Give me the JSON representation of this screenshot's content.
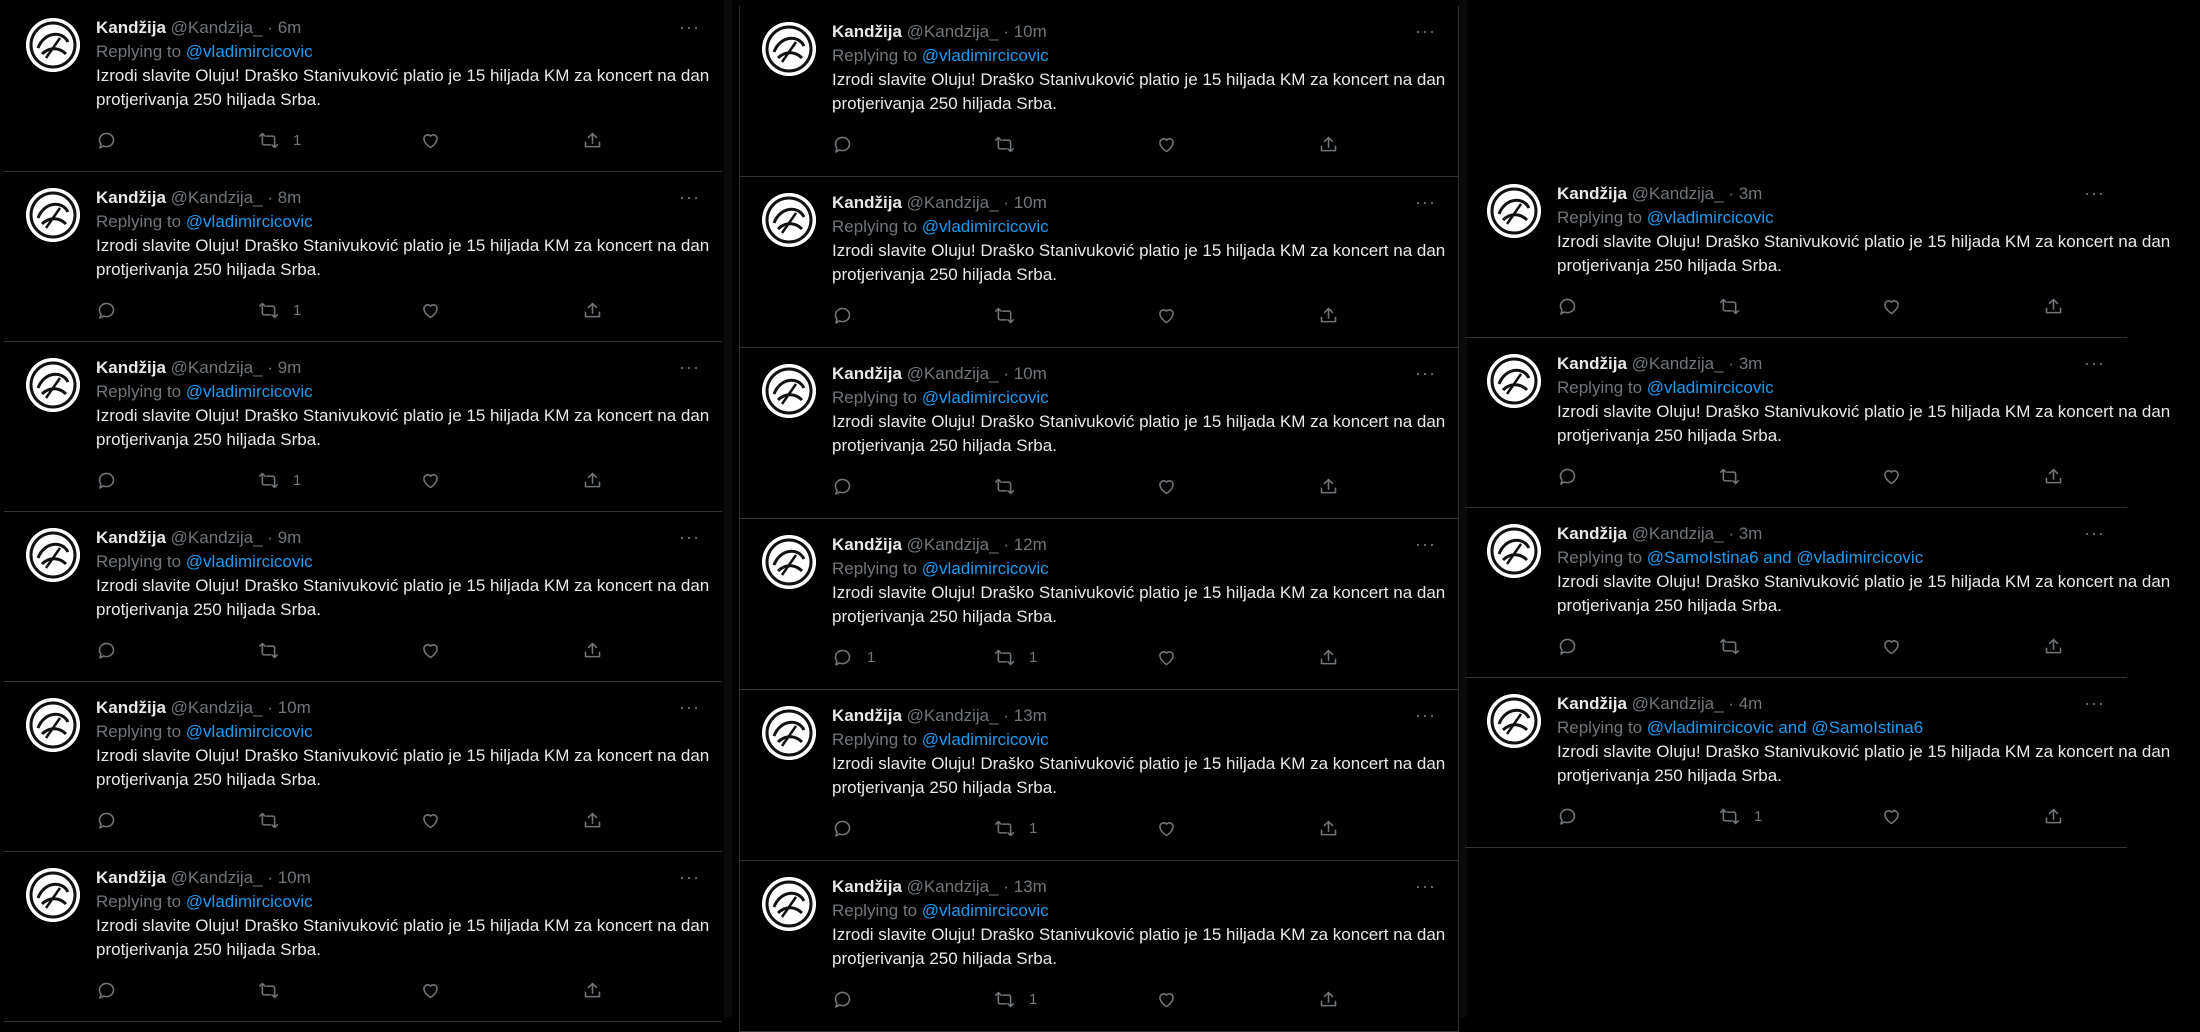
{
  "tweet_text": "Izrodi slavite Oluju! Draško Stanivuković platio je 15 hiljada KM za koncert na dan protjerivanja 250 hiljada Srba.",
  "columns": [
    {
      "tweets": [
        {
          "name": "Kandžija",
          "handle": "@Kandzija_",
          "time": "6m",
          "reply_prefix": "Replying to",
          "mentions": "@vladimircicovic",
          "replies": "",
          "retweets": "1",
          "likes": ""
        },
        {
          "name": "Kandžija",
          "handle": "@Kandzija_",
          "time": "8m",
          "reply_prefix": "Replying to",
          "mentions": "@vladimircicovic",
          "replies": "",
          "retweets": "1",
          "likes": ""
        },
        {
          "name": "Kandžija",
          "handle": "@Kandzija_",
          "time": "9m",
          "reply_prefix": "Replying to",
          "mentions": "@vladimircicovic",
          "replies": "",
          "retweets": "1",
          "likes": ""
        },
        {
          "name": "Kandžija",
          "handle": "@Kandzija_",
          "time": "9m",
          "reply_prefix": "Replying to",
          "mentions": "@vladimircicovic",
          "replies": "",
          "retweets": "",
          "likes": ""
        },
        {
          "name": "Kandžija",
          "handle": "@Kandzija_",
          "time": "10m",
          "reply_prefix": "Replying to",
          "mentions": "@vladimircicovic",
          "replies": "",
          "retweets": "",
          "likes": ""
        },
        {
          "name": "Kandžija",
          "handle": "@Kandzija_",
          "time": "10m",
          "reply_prefix": "Replying to",
          "mentions": "@vladimircicovic",
          "replies": "",
          "retweets": "",
          "likes": ""
        }
      ]
    },
    {
      "tweets": [
        {
          "name": "Kandžija",
          "handle": "@Kandzija_",
          "time": "10m",
          "reply_prefix": "Replying to",
          "mentions": "@vladimircicovic",
          "replies": "",
          "retweets": "",
          "likes": ""
        },
        {
          "name": "Kandžija",
          "handle": "@Kandzija_",
          "time": "10m",
          "reply_prefix": "Replying to",
          "mentions": "@vladimircicovic",
          "replies": "",
          "retweets": "",
          "likes": ""
        },
        {
          "name": "Kandžija",
          "handle": "@Kandzija_",
          "time": "10m",
          "reply_prefix": "Replying to",
          "mentions": "@vladimircicovic",
          "replies": "",
          "retweets": "",
          "likes": ""
        },
        {
          "name": "Kandžija",
          "handle": "@Kandzija_",
          "time": "12m",
          "reply_prefix": "Replying to",
          "mentions": "@vladimircicovic",
          "replies": "1",
          "retweets": "1",
          "likes": ""
        },
        {
          "name": "Kandžija",
          "handle": "@Kandzija_",
          "time": "13m",
          "reply_prefix": "Replying to",
          "mentions": "@vladimircicovic",
          "replies": "",
          "retweets": "1",
          "likes": ""
        },
        {
          "name": "Kandžija",
          "handle": "@Kandzija_",
          "time": "13m",
          "reply_prefix": "Replying to",
          "mentions": "@vladimircicovic",
          "replies": "",
          "retweets": "1",
          "likes": ""
        }
      ]
    },
    {
      "tweets": [
        {
          "name": "Kandžija",
          "handle": "@Kandzija_",
          "time": "3m",
          "reply_prefix": "Replying to",
          "mentions": "@vladimircicovic",
          "replies": "",
          "retweets": "",
          "likes": ""
        },
        {
          "name": "Kandžija",
          "handle": "@Kandzija_",
          "time": "3m",
          "reply_prefix": "Replying to",
          "mentions": "@vladimircicovic",
          "replies": "",
          "retweets": "",
          "likes": ""
        },
        {
          "name": "Kandžija",
          "handle": "@Kandzija_",
          "time": "3m",
          "reply_prefix": "Replying to",
          "mentions": "@SamoIstina6 and @vladimircicovic",
          "replies": "",
          "retweets": "",
          "likes": ""
        },
        {
          "name": "Kandžija",
          "handle": "@Kandzija_",
          "time": "4m",
          "reply_prefix": "Replying to",
          "mentions": "@vladimircicovic and @SamoIstina6",
          "replies": "",
          "retweets": "1",
          "likes": ""
        }
      ]
    }
  ],
  "colors": {
    "background": "#000000",
    "text": "#e7e9ea",
    "muted": "#71767b",
    "accent": "#1d9bf0",
    "border": "#2f3336"
  },
  "icons": {
    "more": "more-dots-icon",
    "reply": "reply-icon",
    "retweet": "retweet-icon",
    "like": "heart-icon",
    "share": "share-icon"
  }
}
